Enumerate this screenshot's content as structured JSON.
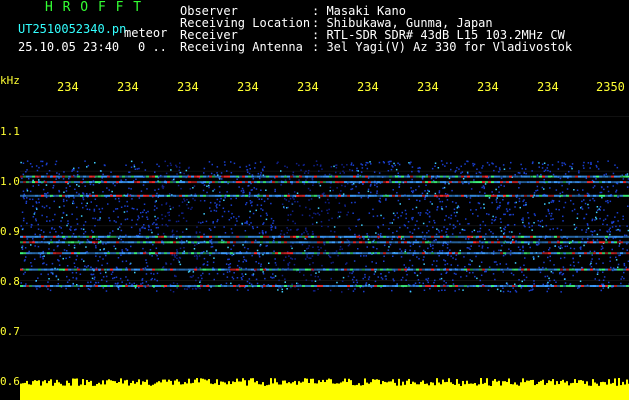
{
  "header": {
    "logo": "H R O F F T",
    "filename": "UT2510052340.pn",
    "mode": "meteor",
    "datetime": "25.10.05 23:40",
    "count": "0 .."
  },
  "info": {
    "labels": [
      "Observer",
      "Receiving Location",
      "Receiver",
      "Receiving Antenna"
    ],
    "values": [
      ": Masaki Kano",
      ": Shibukawa, Gunma, Japan",
      ": RTL-SDR SDR# 43dB L15 103.2MHz CW",
      ": 3el Yagi(V) Az 330 for Vladivostok"
    ]
  },
  "axis": {
    "unit": "kHz",
    "y_ticks": [
      "1.1",
      "1.0",
      "0.9",
      "0.8",
      "0.7",
      "0.6"
    ],
    "x_ticks": [
      "234",
      "234",
      "234",
      "234",
      "234",
      "234",
      "234",
      "234",
      "234",
      "2350"
    ]
  },
  "colors": {
    "background": "#000000",
    "grid": "#ffffff",
    "text_green": "#33ff33",
    "text_cyan": "#33ffff",
    "text_yellow": "#ffff33",
    "signal_blue": "#1a3fd0",
    "signal_red": "#ff3030",
    "noise_floor": "#ffff00"
  },
  "spectrogram": {
    "freq_range_khz": [
      0.6,
      1.13
    ],
    "band_khz": [
      0.78,
      1.02
    ],
    "lines_khz": [
      0.99,
      0.98,
      0.955,
      0.88,
      0.87,
      0.85,
      0.82,
      0.79
    ]
  }
}
